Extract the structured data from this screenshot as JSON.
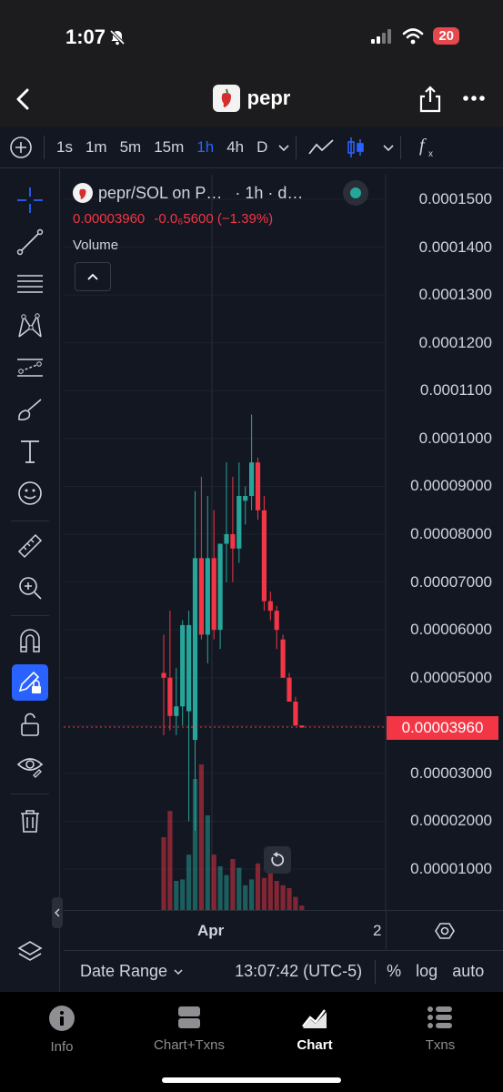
{
  "status": {
    "time": "1:07",
    "battery": "20"
  },
  "nav": {
    "title": "pepr",
    "token_icon": "pepper-logo"
  },
  "toolbar": {
    "timeframes": [
      "1s",
      "1m",
      "5m",
      "15m",
      "1h",
      "4h",
      "D"
    ],
    "active_timeframe": "1h"
  },
  "legend": {
    "title": "pepr/SOL on P…",
    "interval": "· 1h · d…",
    "last": "0.00003960",
    "change": "-0.0₆5600",
    "change_pct": "(−1.39%)",
    "volume_label": "Volume"
  },
  "price_axis": {
    "labels": [
      "0.0001500",
      "0.0001400",
      "0.0001300",
      "0.0001200",
      "0.0001100",
      "0.0001000",
      "0.00009000",
      "0.00008000",
      "0.00007000",
      "0.00006000",
      "0.00005000",
      "0.00004000",
      "0.00003000",
      "0.00002000",
      "0.00001000"
    ],
    "current_price": "0.00003960"
  },
  "time_axis": {
    "labels": [
      "Apr",
      "2"
    ]
  },
  "bottom_bar": {
    "date_range": "Date Range",
    "clock": "13:07:42 (UTC-5)",
    "percent": "%",
    "log": "log",
    "auto": "auto"
  },
  "tabs": [
    {
      "label": "Info",
      "icon": "info-icon"
    },
    {
      "label": "Chart+Txns",
      "icon": "split-icon"
    },
    {
      "label": "Chart",
      "icon": "chart-icon"
    },
    {
      "label": "Txns",
      "icon": "list-icon"
    }
  ],
  "colors": {
    "up": "#26a69a",
    "down": "#f23645",
    "accent": "#2962ff",
    "background": "#131722"
  },
  "chart_data": {
    "type": "candlestick",
    "interval": "1h",
    "ylim": [
      0,
      0.000155
    ],
    "candles": [
      {
        "o": 5.1e-05,
        "h": 5.9e-05,
        "l": 3.8e-05,
        "c": 5e-05
      },
      {
        "o": 5e-05,
        "h": 6.4e-05,
        "l": 3.9e-05,
        "c": 4.2e-05
      },
      {
        "o": 4.2e-05,
        "h": 5.2e-05,
        "l": 3.8e-05,
        "c": 4.4e-05
      },
      {
        "o": 4.4e-05,
        "h": 6.2e-05,
        "l": 4e-05,
        "c": 6.1e-05
      },
      {
        "o": 4.3e-05,
        "h": 6.4e-05,
        "l": 2e-05,
        "c": 6.1e-05
      },
      {
        "o": 3.7e-05,
        "h": 8.9e-05,
        "l": 1.8e-05,
        "c": 7.5e-05
      },
      {
        "o": 7.5e-05,
        "h": 9.2e-05,
        "l": 5.8e-05,
        "c": 5.9e-05
      },
      {
        "o": 5.9e-05,
        "h": 8.8e-05,
        "l": 5.3e-05,
        "c": 7.5e-05
      },
      {
        "o": 7.5e-05,
        "h": 8.5e-05,
        "l": 5.8e-05,
        "c": 6e-05
      },
      {
        "o": 6e-05,
        "h": 7.8e-05,
        "l": 5.6e-05,
        "c": 7.8e-05
      },
      {
        "o": 7.8e-05,
        "h": 9.5e-05,
        "l": 7e-05,
        "c": 8e-05
      },
      {
        "o": 8e-05,
        "h": 9.2e-05,
        "l": 7e-05,
        "c": 7.7e-05
      },
      {
        "o": 7.7e-05,
        "h": 9.5e-05,
        "l": 7.4e-05,
        "c": 8.8e-05
      },
      {
        "o": 8.7e-05,
        "h": 9e-05,
        "l": 8.2e-05,
        "c": 8.8e-05
      },
      {
        "o": 8.8e-05,
        "h": 0.000105,
        "l": 8.5e-05,
        "c": 9.5e-05
      },
      {
        "o": 9.5e-05,
        "h": 9.6e-05,
        "l": 8.3e-05,
        "c": 8.5e-05
      },
      {
        "o": 8.5e-05,
        "h": 8.8e-05,
        "l": 6.4e-05,
        "c": 6.6e-05
      },
      {
        "o": 6.6e-05,
        "h": 6.8e-05,
        "l": 6.2e-05,
        "c": 6.4e-05
      },
      {
        "o": 6.4e-05,
        "h": 6.5e-05,
        "l": 5.6e-05,
        "c": 6e-05
      },
      {
        "o": 5.8e-05,
        "h": 5.9e-05,
        "l": 5e-05,
        "c": 5e-05
      },
      {
        "o": 5e-05,
        "h": 5.1e-05,
        "l": 4.5e-05,
        "c": 4.5e-05
      },
      {
        "o": 4.5e-05,
        "h": 4.6e-05,
        "l": 4e-05,
        "c": 4e-05
      },
      {
        "o": 4e-05,
        "h": 4e-05,
        "l": 3.95e-05,
        "c": 3.96e-05
      }
    ],
    "volume": [
      0.5,
      0.68,
      0.2,
      0.21,
      0.38,
      0.9,
      1.0,
      0.65,
      0.38,
      0.3,
      0.24,
      0.35,
      0.29,
      0.17,
      0.21,
      0.32,
      0.22,
      0.31,
      0.2,
      0.17,
      0.15,
      0.09,
      0.03
    ]
  }
}
